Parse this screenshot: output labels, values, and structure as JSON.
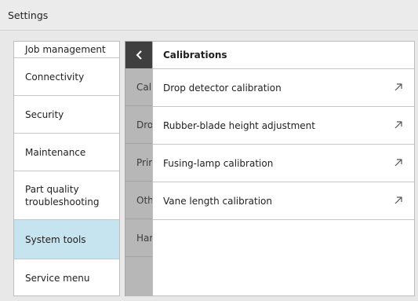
{
  "header": {
    "title": "Settings"
  },
  "left_menu": {
    "items": [
      {
        "label": "Job management",
        "selected": false
      },
      {
        "label": "Connectivity",
        "selected": false
      },
      {
        "label": "Security",
        "selected": false
      },
      {
        "label": "Maintenance",
        "selected": false
      },
      {
        "label": "Part quality troubleshooting",
        "selected": true,
        "note": ""
      },
      {
        "label": "System tools",
        "selected": true
      },
      {
        "label": "Service menu",
        "selected": false
      }
    ]
  },
  "middle_menu": {
    "back_icon": "chevron-left-icon",
    "items": [
      {
        "label": "Cali"
      },
      {
        "label": "Dro"
      },
      {
        "label": "Prir"
      },
      {
        "label": "Oth"
      },
      {
        "label": "Har"
      }
    ]
  },
  "calibrations": {
    "title": "Calibrations",
    "items": [
      {
        "label": "Drop detector calibration",
        "icon": "external-arrow-icon"
      },
      {
        "label": "Rubber-blade height adjustment",
        "icon": "external-arrow-icon"
      },
      {
        "label": "Fusing-lamp calibration",
        "icon": "external-arrow-icon"
      },
      {
        "label": "Vane length calibration",
        "icon": "external-arrow-icon"
      }
    ]
  },
  "colors": {
    "selected_bg": "#c6e4ef",
    "back_button_bg": "#3f3f3f",
    "mid_column_bg": "#b7b7b7"
  }
}
